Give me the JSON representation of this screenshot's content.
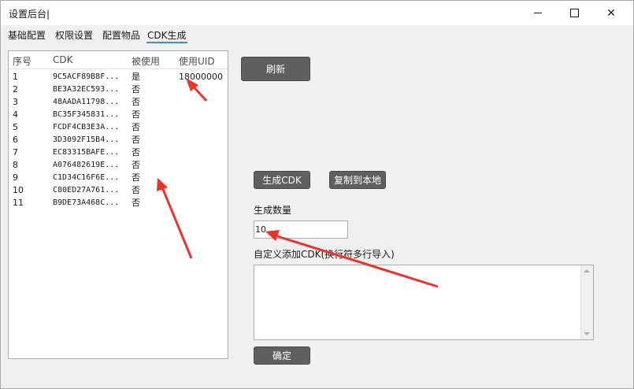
{
  "window": {
    "title": "设置后台|",
    "minimize_glyph": "",
    "maximize_glyph": "",
    "close_glyph": "✕"
  },
  "tabs": [
    {
      "label": "基础配置"
    },
    {
      "label": "权限设置"
    },
    {
      "label": "配置物品"
    },
    {
      "label": "CDK生成"
    }
  ],
  "cdk_list": {
    "headers": [
      "序号",
      "CDK",
      "被使用",
      "使用UID"
    ],
    "rows": [
      {
        "index": "1",
        "cdk": "9C5ACF89B8F...",
        "used": "是",
        "uid": "18000000"
      },
      {
        "index": "2",
        "cdk": "BE3A32EC593...",
        "used": "否",
        "uid": ""
      },
      {
        "index": "3",
        "cdk": "48AADA11798...",
        "used": "否",
        "uid": ""
      },
      {
        "index": "4",
        "cdk": "BC35F345831...",
        "used": "否",
        "uid": ""
      },
      {
        "index": "5",
        "cdk": "FCDF4CB3E3A...",
        "used": "否",
        "uid": ""
      },
      {
        "index": "6",
        "cdk": "3D3092F15B4...",
        "used": "否",
        "uid": ""
      },
      {
        "index": "7",
        "cdk": "EC83315BAFE...",
        "used": "否",
        "uid": ""
      },
      {
        "index": "8",
        "cdk": "A076482619E...",
        "used": "否",
        "uid": ""
      },
      {
        "index": "9",
        "cdk": "C1D34C16F6E...",
        "used": "否",
        "uid": ""
      },
      {
        "index": "10",
        "cdk": "C80ED27A761...",
        "used": "否",
        "uid": ""
      },
      {
        "index": "11",
        "cdk": "B9DE73A468C...",
        "used": "否",
        "uid": ""
      }
    ]
  },
  "buttons": {
    "refresh": "刷新",
    "generate": "生成CDK",
    "copy_local": "复制到本地",
    "confirm": "确定"
  },
  "form": {
    "count_label": "生成数量",
    "count_value": "10",
    "custom_label": "自定义添加CDK(换行符多行导入)",
    "custom_value": ""
  },
  "colors": {
    "button_bg": "#5f5f5f",
    "active_tab_underline": "#3c8cd8",
    "annotation_arrow": "#e8352b"
  }
}
